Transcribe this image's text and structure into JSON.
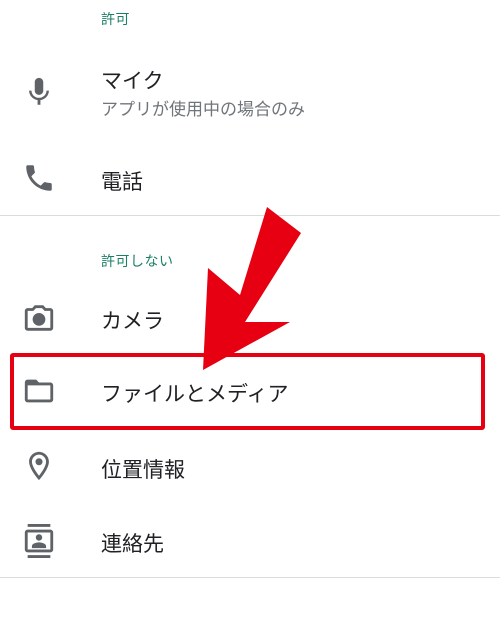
{
  "allowed": {
    "header": "許可",
    "items": [
      {
        "title": "マイク",
        "subtitle": "アプリが使用中の場合のみ",
        "icon": "microphone-icon"
      },
      {
        "title": "電話",
        "icon": "phone-icon"
      }
    ]
  },
  "denied": {
    "header": "許可しない",
    "items": [
      {
        "title": "カメラ",
        "icon": "camera-icon"
      },
      {
        "title": "ファイルとメディア",
        "icon": "folder-icon"
      },
      {
        "title": "位置情報",
        "icon": "location-icon"
      },
      {
        "title": "連絡先",
        "icon": "contacts-icon"
      }
    ]
  },
  "annotation": {
    "highlight_color": "#e60012",
    "highlighted_item": "ファイルとメディア"
  },
  "colors": {
    "section_header": "#1a7f64",
    "icon": "#5f6368",
    "subtitle": "#70757a",
    "divider": "#dadce0"
  }
}
